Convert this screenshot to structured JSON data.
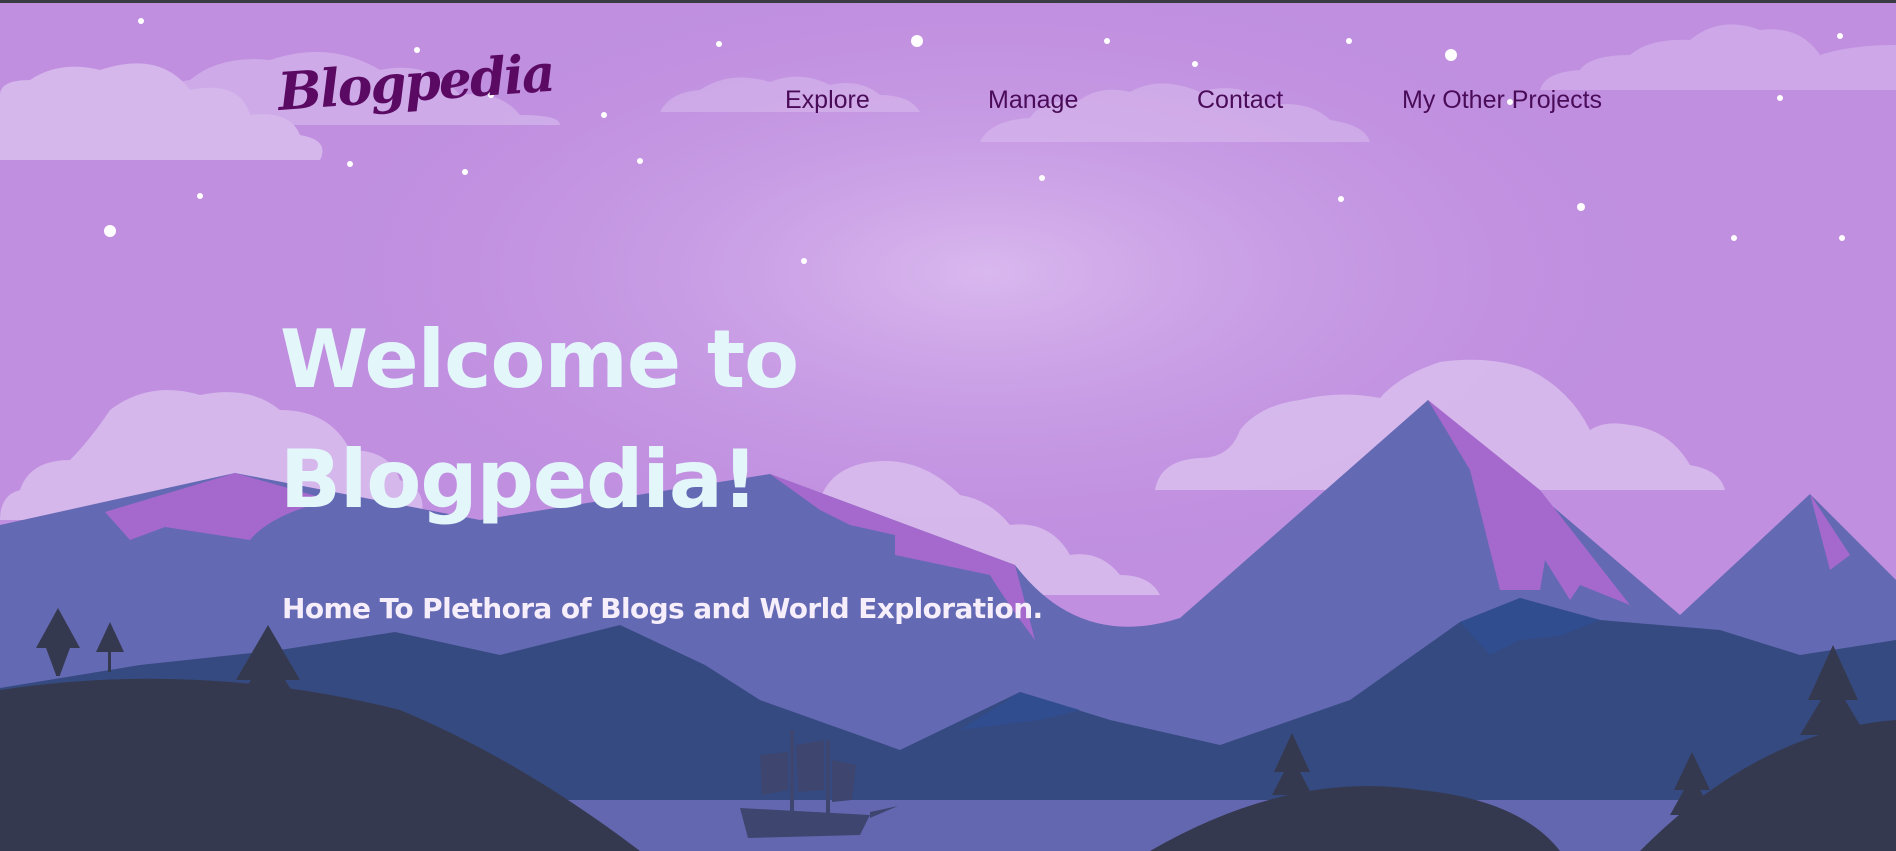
{
  "brand": {
    "logo_text": "Blogpedia"
  },
  "nav": {
    "items": [
      {
        "label": "Explore"
      },
      {
        "label": "Manage"
      },
      {
        "label": "Contact"
      },
      {
        "label": "My Other Projects"
      }
    ]
  },
  "hero": {
    "headline_line1": "Welcome to",
    "headline_line2": "Blogpedia!",
    "tagline": "Home To Plethora of Blogs and World Exploration."
  },
  "colors": {
    "sky": "#c08fe0",
    "logo": "#5b0a63",
    "nav_text": "#4a0c58",
    "headline": "#e3f7fb",
    "mountains_far": "#6469b3",
    "mountains_near": "#354a80",
    "foreground_hills": "#35394f",
    "snow_caps": "#a569cd"
  }
}
